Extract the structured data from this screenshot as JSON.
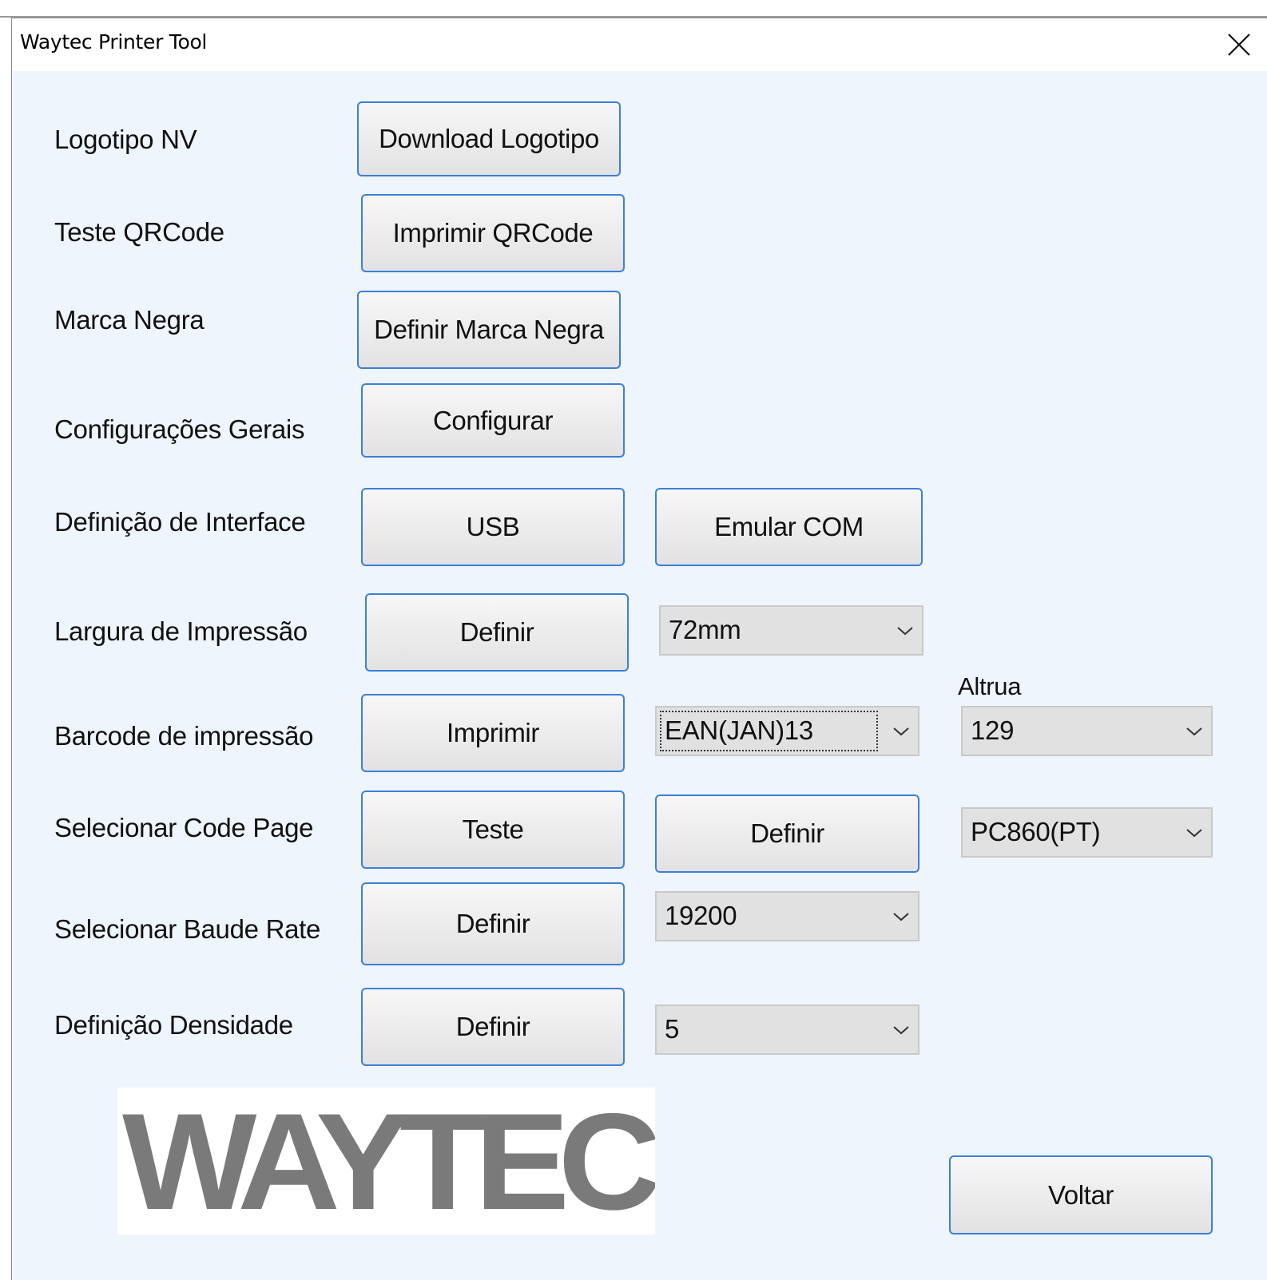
{
  "window": {
    "title": "Waytec Printer Tool"
  },
  "rows": {
    "logo": {
      "label": "Logotipo NV",
      "button": "Download Logotipo"
    },
    "qrcode": {
      "label": "Teste QRCode",
      "button": "Imprimir QRCode"
    },
    "black_mark": {
      "label": "Marca Negra",
      "button": "Definir Marca Negra"
    },
    "general": {
      "label": "Configurações Gerais",
      "button": "Configurar"
    },
    "interface": {
      "label": "Definição de Interface",
      "button_usb": "USB",
      "button_com": "Emular COM"
    },
    "print_width": {
      "label": "Largura de Impressão",
      "button": "Definir",
      "select_value": "72mm"
    },
    "barcode": {
      "label": "Barcode de impressão",
      "button": "Imprimir",
      "type_value": "EAN(JAN)13",
      "height_label": "Altrua",
      "height_value": "129"
    },
    "code_page": {
      "label": "Selecionar Code Page",
      "test_button": "Teste",
      "set_button": "Definir",
      "select_value": "PC860(PT)"
    },
    "baud_rate": {
      "label": "Selecionar Baude Rate",
      "button": "Definir",
      "select_value": "19200"
    },
    "density": {
      "label": "Definição Densidade",
      "button": "Definir",
      "select_value": "5"
    }
  },
  "logo_text": "WAYTEC",
  "back_button": "Voltar",
  "colors": {
    "window_bg": "#eef5fc",
    "button_border": "#3b7fd9",
    "combo_bg": "#e1e1e1",
    "logo_gray": "#7a7a7a"
  }
}
